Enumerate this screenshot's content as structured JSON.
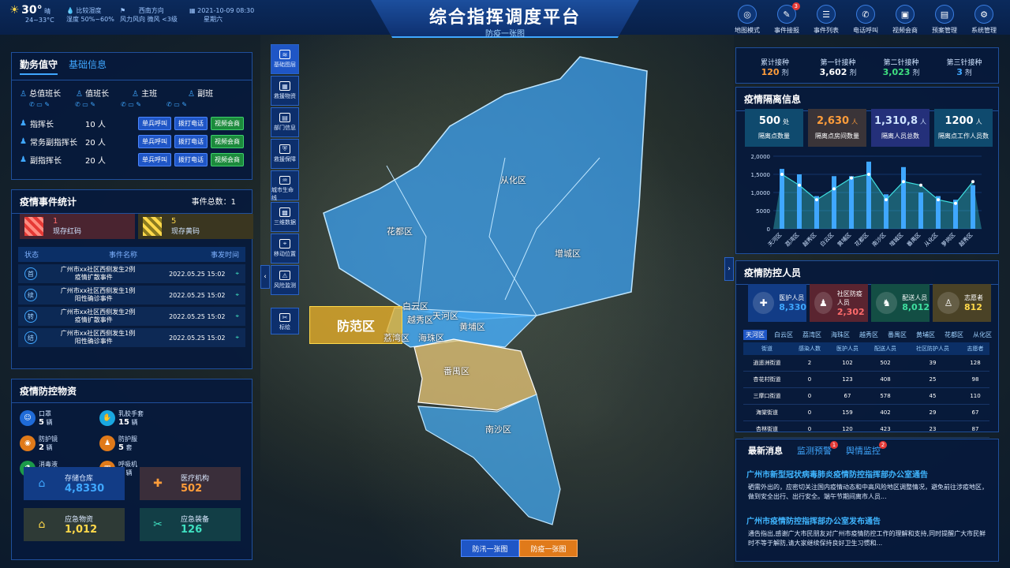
{
  "header": {
    "title": "综合指挥调度平台",
    "subtitle": "防疫一张图"
  },
  "weather": {
    "temp": "30°",
    "temp_unit": "晴",
    "temp_range": "24~33°C",
    "humidity_label": "比较湿度",
    "humidity_sub": "湿度",
    "humidity_value": "50%~60%",
    "wind_label": "风力风向",
    "wind_dir": "西南方向",
    "wind_level": "微风 <3级",
    "date": "2021-10-09",
    "time": "08:30",
    "weekday": "星期六"
  },
  "topnav": [
    {
      "label": "地图模式",
      "icon": "globe-icon",
      "glyph": "◎"
    },
    {
      "label": "事件接报",
      "icon": "report-icon",
      "glyph": "✎",
      "badge": "3"
    },
    {
      "label": "事件列表",
      "icon": "list-icon",
      "glyph": "☰"
    },
    {
      "label": "电话呼叫",
      "icon": "phone-icon",
      "glyph": "✆"
    },
    {
      "label": "视频会商",
      "icon": "video-icon",
      "glyph": "▣"
    },
    {
      "label": "预案管理",
      "icon": "plan-icon",
      "glyph": "▤"
    },
    {
      "label": "系统管理",
      "icon": "system-icon",
      "glyph": "⚙"
    }
  ],
  "duty": {
    "tab_active": "勤务值守",
    "tab_other": "基础信息",
    "roles": [
      "总值班长",
      "值班长",
      "主班",
      "副班"
    ],
    "leaders": [
      {
        "name": "指挥长",
        "count": "10 人"
      },
      {
        "name": "常务副指挥长",
        "count": "20 人"
      },
      {
        "name": "副指挥长",
        "count": "20 人"
      }
    ],
    "btn1": "单兵呼叫",
    "btn2": "拨打电话",
    "btn3": "视频会商"
  },
  "events": {
    "title": "疫情事件统计",
    "total_label": "事件总数：",
    "total": "1",
    "red_count": "1",
    "red_label": "现存红码",
    "yellow_count": "5",
    "yellow_label": "现存黄码",
    "headers": [
      "状态",
      "事件名称",
      "事发时间"
    ],
    "rows": [
      {
        "status": "首",
        "name1": "广州市xx社区西侧发生2例",
        "name2": "疫情扩散事件",
        "time": "2022.05.25  15:02"
      },
      {
        "status": "续",
        "name1": "广州市xx社区西侧发生1例",
        "name2": "阳性确诊事件",
        "time": "2022.05.25  15:02"
      },
      {
        "status": "转",
        "name1": "广州市xx社区西侧发生2例",
        "name2": "疫情扩散事件",
        "time": "2022.05.25  15:02"
      },
      {
        "status": "结",
        "name1": "广州市xx社区西侧发生1例",
        "name2": "阳性确诊事件",
        "time": "2022.05.25  15:02"
      }
    ]
  },
  "materials": {
    "title": "疫情防控物资",
    "items": [
      {
        "name": "口罩",
        "value": "5",
        "unit": "辆",
        "color": "#1f6bd8",
        "glyph": "☺"
      },
      {
        "name": "乳胶手套",
        "value": "15",
        "unit": "辆",
        "color": "#1aa8e0",
        "glyph": "✋"
      },
      {
        "name": "防护镜",
        "value": "2",
        "unit": "辆",
        "color": "#e07a1a",
        "glyph": "◉"
      },
      {
        "name": "防护服",
        "value": "5",
        "unit": "套",
        "color": "#e07a1a",
        "glyph": "♟"
      },
      {
        "name": "消毒液",
        "value": "0",
        "unit": "辆",
        "color": "#1c9a4a",
        "glyph": "⚗"
      },
      {
        "name": "呼吸机",
        "value": "0",
        "unit": "辆",
        "color": "#e07a1a",
        "glyph": "▥"
      }
    ],
    "boxes": [
      {
        "label": "存储仓库",
        "value": "4,8330",
        "color": "#3fa7ff",
        "bg": "#123c86"
      },
      {
        "label": "医疗机构",
        "value": "502",
        "color": "#ff9d3a",
        "bg": "#3a2e3a"
      },
      {
        "label": "应急物资",
        "value": "1,012",
        "color": "#ffd94a",
        "bg": "#2e3a36"
      },
      {
        "label": "应急装备",
        "value": "126",
        "color": "#3fe0c0",
        "bg": "#123e46"
      }
    ]
  },
  "tools": [
    {
      "label": "基础图层",
      "glyph": "≋"
    },
    {
      "label": "救援物资",
      "glyph": "▦"
    },
    {
      "label": "部门信息",
      "glyph": "▤"
    },
    {
      "label": "救援保障",
      "glyph": "⛨"
    },
    {
      "label": "城市生命线",
      "glyph": "♒"
    },
    {
      "label": "三维数据",
      "glyph": "▩"
    },
    {
      "label": "移动位置",
      "glyph": "⌖"
    },
    {
      "label": "风险监测",
      "glyph": "⚠"
    },
    {
      "label": "标绘",
      "glyph": "✂"
    }
  ],
  "map": {
    "districts": [
      "从化区",
      "花都区",
      "增城区",
      "白云区",
      "越秀区",
      "天河区",
      "黄埔区",
      "荔湾区",
      "海珠区",
      "番禺区",
      "南沙区"
    ],
    "highlight_label": "防范区"
  },
  "vaccine": [
    {
      "label": "累计接种",
      "value": "120",
      "unit": "剂",
      "color": "#ff9d3a"
    },
    {
      "label": "第一针接种",
      "value": "3,602",
      "unit": "剂",
      "color": "#fff"
    },
    {
      "label": "第二针接种",
      "value": "3,023",
      "unit": "剂",
      "color": "#3fe080"
    },
    {
      "label": "第三针接种",
      "value": "3",
      "unit": "剂",
      "color": "#3fa7ff"
    }
  ],
  "isolation": {
    "title": "疫情隔离信息",
    "boxes": [
      {
        "value": "500",
        "unit": "处",
        "label": "隔离点数量",
        "color": "#fff",
        "bg": "#0f4a6e"
      },
      {
        "value": "2,630",
        "unit": "人",
        "label": "隔离点房间数量",
        "color": "#ff9d3a",
        "bg": "#3a3438"
      },
      {
        "value": "1,310,8",
        "unit": "人",
        "label": "隔离人员总数",
        "color": "#cfe3ff",
        "bg": "#24307a"
      },
      {
        "value": "1200",
        "unit": "人",
        "label": "隔离点工作人员数",
        "color": "#fff",
        "bg": "#0f4a6e"
      }
    ]
  },
  "chart_data": {
    "type": "bar",
    "categories": [
      "天河区",
      "荔湾区",
      "越秀区",
      "白云区",
      "黄埔区",
      "花都区",
      "南沙区",
      "增城区",
      "番禺区",
      "从化区",
      "萝岗区",
      "越秀区"
    ],
    "values": [
      1650,
      1500,
      900,
      1450,
      1450,
      1850,
      950,
      1700,
      1000,
      900,
      800,
      1200
    ],
    "line_values": [
      1500,
      1200,
      800,
      1100,
      1400,
      1500,
      800,
      1300,
      1200,
      800,
      700,
      1300
    ],
    "ylim": [
      0,
      2000
    ],
    "yticks": [
      "2,0000",
      "1,5000",
      "1,0000",
      "5000",
      "0"
    ],
    "ylabel": "",
    "xlabel": "",
    "title": ""
  },
  "personnel": {
    "title": "疫情防控人员",
    "boxes": [
      {
        "label": "医护人员",
        "value": "8,330",
        "color": "#3fa7ff",
        "bg": "#123c86",
        "glyph": "✚"
      },
      {
        "label": "社区防疫人员",
        "value": "2,302",
        "color": "#ff6b6b",
        "bg": "#5a2430",
        "glyph": "♟"
      },
      {
        "label": "配送人员",
        "value": "8,012",
        "color": "#3fe0a0",
        "bg": "#134e44",
        "glyph": "♞"
      },
      {
        "label": "志愿者",
        "value": "812",
        "color": "#ffd94a",
        "bg": "#4a4226",
        "glyph": "♙"
      }
    ],
    "tabs": [
      "天河区",
      "白云区",
      "荔湾区",
      "海珠区",
      "越秀区",
      "番禺区",
      "黄埔区",
      "花都区",
      "从化区"
    ],
    "headers": [
      "街道",
      "感染人数",
      "医护人员",
      "配送人员",
      "社区防护人员",
      "志愿者"
    ],
    "rows": [
      [
        "逍遥洲街道",
        "2",
        "102",
        "502",
        "39",
        "128"
      ],
      [
        "杏花村街道",
        "0",
        "123",
        "408",
        "25",
        "98"
      ],
      [
        "三摩口街道",
        "0",
        "67",
        "578",
        "45",
        "110"
      ],
      [
        "海棠街道",
        "0",
        "159",
        "402",
        "29",
        "67"
      ],
      [
        "杏林街道",
        "0",
        "120",
        "423",
        "23",
        "87"
      ]
    ]
  },
  "news": {
    "tab_active": "最新消息",
    "tab2": "监测预警",
    "tab2_badge": "1",
    "tab3": "舆情监控",
    "tab3_badge": "2",
    "items": [
      {
        "title": "广州市新型冠状病毒肺炎疫情防控指挥部办公室通告",
        "body1": "硒需外出的，应密切关注国内疫情动态和中高风险地区调整情况，避免前往涉疫地区，",
        "body2": "做到安全出行、出行安全。端午节期间离市人员..."
      },
      {
        "title": "广州市疫情防控指挥部办公室发布通告",
        "body1": "通告指出,感谢广大市民朋友对广州市疫情防控工作的理解和支持,同时提醒广大市民鲜",
        "body2": "时不等于解防,请大家继续保持良好卫生习惯和..."
      }
    ]
  },
  "bottom": {
    "btn1": "防汛一张图",
    "btn2": "防疫一张图"
  }
}
